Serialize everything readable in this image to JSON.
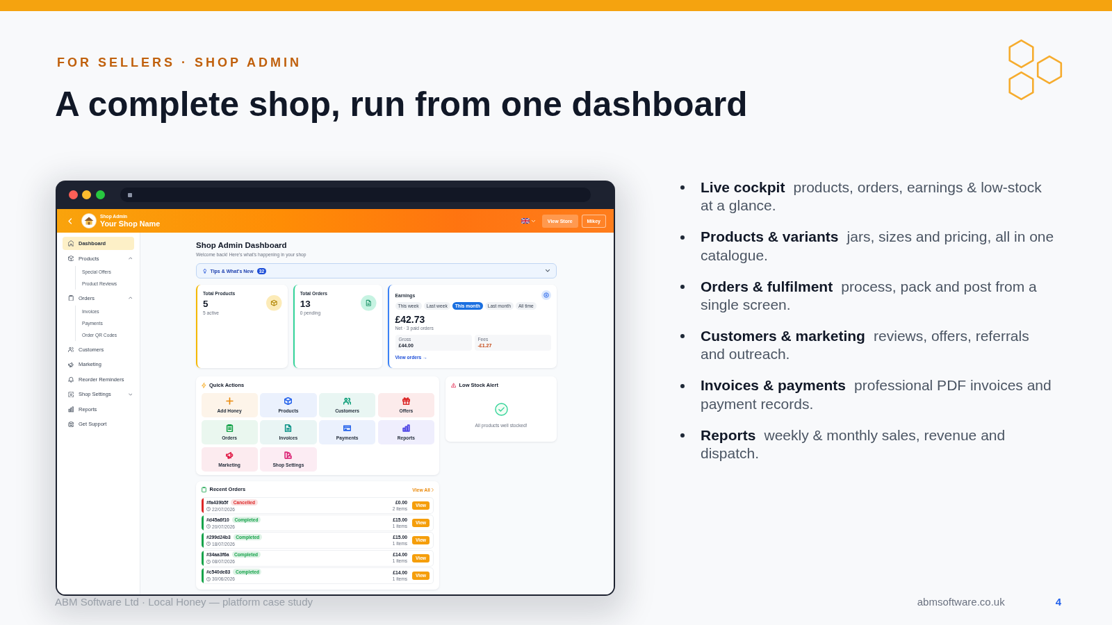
{
  "slide": {
    "kicker": "FOR SELLERS · SHOP ADMIN",
    "title": "A complete shop, run from one dashboard"
  },
  "mockup": {
    "header": {
      "subtitle": "Shop Admin",
      "shop_name": "Your Shop Name",
      "buttons": [
        {
          "label": "View Store",
          "kind": "filled"
        },
        {
          "label": "Mikey",
          "kind": "outline"
        }
      ]
    },
    "sidebar": {
      "items": [
        {
          "label": "Dashboard",
          "selected": true
        },
        {
          "label": "Products",
          "selected": false,
          "expanded": true,
          "children": [
            {
              "label": "Special Offers",
              "selected": false
            },
            {
              "label": "Product Reviews",
              "selected": false
            }
          ]
        },
        {
          "label": "Orders",
          "selected": false,
          "expanded": true,
          "children": [
            {
              "label": "Invoices",
              "selected": false
            },
            {
              "label": "Payments",
              "selected": false
            },
            {
              "label": "Order QR Codes",
              "selected": false
            }
          ]
        },
        {
          "label": "Customers",
          "selected": false
        },
        {
          "label": "Marketing",
          "selected": false
        },
        {
          "label": "Reorder Reminders",
          "selected": false
        },
        {
          "label": "Shop Settings",
          "selected": false,
          "expanded": false
        },
        {
          "label": "Reports",
          "selected": false
        },
        {
          "label": "Get Support",
          "selected": false
        }
      ]
    },
    "dashboard": {
      "title": "Shop Admin Dashboard",
      "subtitle": "Welcome back! Here's what's happening in your shop",
      "tips": {
        "label": "Tips & What's New",
        "count": "32"
      },
      "stats": [
        {
          "label": "Total Products",
          "value": "5",
          "note": "5 active",
          "color": "#f5b800"
        },
        {
          "label": "Total Orders",
          "value": "13",
          "note": "0 pending",
          "color": "#34d399"
        }
      ],
      "earnings": {
        "title": "Earnings",
        "periods": [
          {
            "label": "This week",
            "selected": false
          },
          {
            "label": "Last week",
            "selected": false
          },
          {
            "label": "This month",
            "selected": true
          },
          {
            "label": "Last month",
            "selected": false
          },
          {
            "label": "All time",
            "selected": false
          }
        ],
        "amount": "£42.73",
        "note": "Net · 3 paid orders",
        "breakdown": [
          {
            "label": "Gross",
            "value": "£44.00",
            "kind": "gross"
          },
          {
            "label": "Fees",
            "value": "-£1.27",
            "kind": "fee"
          }
        ],
        "link": "View orders →"
      },
      "quick_actions": {
        "title": "Quick Actions",
        "items": [
          {
            "label": "Add Honey",
            "color": "#ea8a0c"
          },
          {
            "label": "Products",
            "color": "#2563eb"
          },
          {
            "label": "Customers",
            "color": "#0f9f7a"
          },
          {
            "label": "Offers",
            "color": "#dc2626"
          },
          {
            "label": "Orders",
            "color": "#16a34a"
          },
          {
            "label": "Invoices",
            "color": "#0d9488"
          },
          {
            "label": "Payments",
            "color": "#2563eb"
          },
          {
            "label": "Reports",
            "color": "#4f46e5"
          },
          {
            "label": "Marketing",
            "color": "#e11d48"
          },
          {
            "label": "Shop Settings",
            "color": "#db2777"
          }
        ]
      },
      "low_stock": {
        "title": "Low Stock Alert",
        "message": "All products well stocked!"
      },
      "recent_orders": {
        "title": "Recent Orders",
        "link": "View All",
        "rows": [
          {
            "id": "#fa439b5f",
            "status": "Cancelled",
            "color": "#dc2626",
            "date": "22/07/2026",
            "amount": "£0.00",
            "items": "2 items",
            "action": "View"
          },
          {
            "id": "#d45a6f10",
            "status": "Completed",
            "color": "#16a34a",
            "date": "20/07/2026",
            "amount": "£15.00",
            "items": "1 items",
            "action": "View"
          },
          {
            "id": "#299d24b3",
            "status": "Completed",
            "color": "#16a34a",
            "date": "18/07/2026",
            "amount": "£15.00",
            "items": "1 items",
            "action": "View"
          },
          {
            "id": "#34aa3f6a",
            "status": "Completed",
            "color": "#16a34a",
            "date": "08/07/2026",
            "amount": "£14.00",
            "items": "1 items",
            "action": "View"
          },
          {
            "id": "#c540de83",
            "status": "Completed",
            "color": "#16a34a",
            "date": "30/06/2026",
            "amount": "£14.00",
            "items": "1 items",
            "action": "View"
          }
        ]
      }
    }
  },
  "bullets": [
    {
      "text": "**Live cockpit** products, orders, earnings & low-stock at a glance."
    },
    {
      "text": "**Products & variants** jars, sizes and pricing, all in one catalogue."
    },
    {
      "text": "**Orders & fulfilment** process, pack and post from a single screen."
    },
    {
      "text": "**Customers & marketing** reviews, offers, referrals and outreach."
    },
    {
      "text": "**Invoices & payments** professional PDF invoices and payment records."
    },
    {
      "text": "**Reports** weekly & monthly sales, revenue and dispatch."
    }
  ],
  "footer": {
    "caption": "ABM Software Ltd · Local Honey — platform case study",
    "site": "abmsoftware.co.uk",
    "page": "4"
  }
}
